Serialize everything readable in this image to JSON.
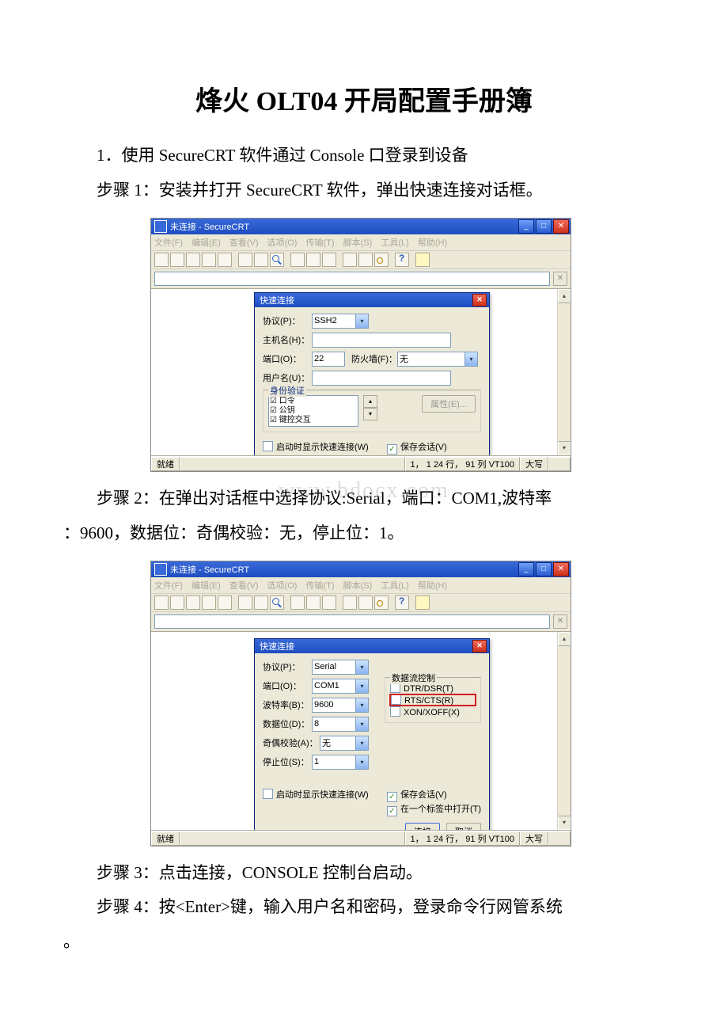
{
  "doc": {
    "title": "烽火 OLT04 开局配置手册簿",
    "p1": "1．使用 SecureCRT 软件通过 Console 口登录到设备",
    "p2": "步骤 1：安装并打开 SecureCRT 软件，弹出快速连接对话框。",
    "p3a": "步骤 2：在弹出对话框中选择协议:Serial，端口：COM1,波特率",
    "p3b": "：9600，数据位：奇偶校验：无，停止位：1。",
    "p4": "步骤 3：点击连接，CONSOLE 控制台启动。",
    "p5": "步骤 4：按<Enter>键，输入用户名和密码，登录命令行网管系统",
    "p5b": "。"
  },
  "win": {
    "title": "未连接 - SecureCRT",
    "menus": [
      "文件(F)",
      "编辑(E)",
      "查看(V)",
      "选项(O)",
      "传输(T)",
      "脚本(S)",
      "工具(L)",
      "帮助(H)"
    ],
    "status_ready": "就绪",
    "status_pos": "1，  1  24 行， 91 列  VT100",
    "status_caps": "大写"
  },
  "dlg": {
    "title": "快速连接",
    "labels": {
      "protocol": "协议(P)：",
      "host": "主机名(H)：",
      "port": "端口(O)：",
      "firewall": "防火墙(F)：",
      "user": "用户名(U)：",
      "baud": "波特率(B)：",
      "databits": "数据位(D)：",
      "parity": "奇偶校验(A)：",
      "stopbits": "停止位(S)："
    },
    "values": {
      "ssh2": "SSH2",
      "serial": "Serial",
      "com1": "COM1",
      "port22": "22",
      "firewall_none": "无",
      "baud9600": "9600",
      "databits8": "8",
      "parity_none": "无",
      "stopbits1": "1"
    },
    "auth_group": "身份验证",
    "auth_items": [
      "口令",
      "公钥",
      "键控交互"
    ],
    "properties_btn": "属性(E)...",
    "flow_group": "数据流控制",
    "flow_items": [
      "DTR/DSR(T)",
      "RTS/CTS(R)",
      "XON/XOFF(X)"
    ],
    "chk_show_quick": "启动时显示快速连接(W)",
    "chk_save_session": "保存会话(V)",
    "chk_open_tab": "在一个标签中打开(T)",
    "btn_connect": "连接",
    "btn_cancel": "取消"
  },
  "watermark": "www.bdocx.com"
}
